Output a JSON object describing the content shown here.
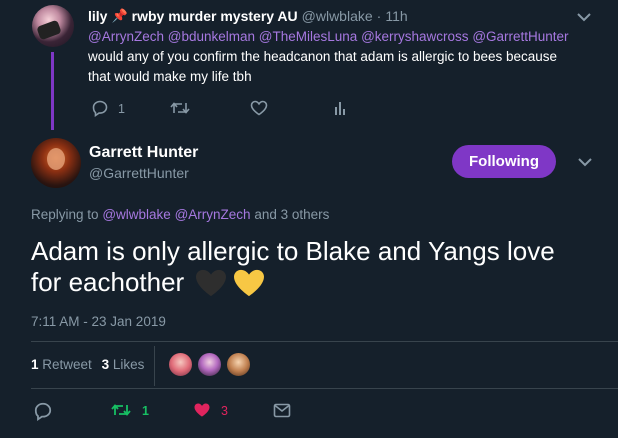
{
  "reply_tweet": {
    "author_name": "lily",
    "pin_emoji": "📌",
    "author_name_suffix": "rwby murder mystery AU",
    "handle": "@wlwblake",
    "separator": "·",
    "time": "11h",
    "mentions": [
      "@ArrynZech",
      "@bdunkelman",
      "@TheMilesLuna",
      "@kerryshawcross",
      "@GarrettHunter"
    ],
    "text_line1": "would any of you confirm the headcanon that adam is allergic to bees because",
    "text_line2": "that would make my life tbh",
    "reply_count": "1",
    "icons": {
      "reply": "reply-icon",
      "retweet": "retweet-icon",
      "like": "like-icon",
      "analytics": "analytics-icon",
      "menu": "chevron-down-icon"
    }
  },
  "main_tweet": {
    "author_name": "Garrett Hunter",
    "handle": "@GarrettHunter",
    "follow_label": "Following",
    "replying_prefix": "Replying to",
    "replying_mentions": [
      "@wlwblake",
      "@ArrynZech"
    ],
    "replying_suffix": "and 3 others",
    "text_line1": "Adam is only allergic to Blake and Yangs love",
    "text_line2": "for eachother",
    "emojis": [
      "black-heart",
      "yellow-heart"
    ],
    "timestamp": "7:11 AM - 23 Jan 2019",
    "retweet_count": "1",
    "retweet_label": "Retweet",
    "likes_count": "3",
    "likes_label": "Likes",
    "action_retweet_count": "1",
    "action_like_count": "3",
    "colors": {
      "accent": "#7f37c6",
      "link": "#a678e0",
      "retweet_green": "#17bf63",
      "like_pink": "#e0245e",
      "muted": "#8899a6",
      "background": "#15202b"
    }
  }
}
